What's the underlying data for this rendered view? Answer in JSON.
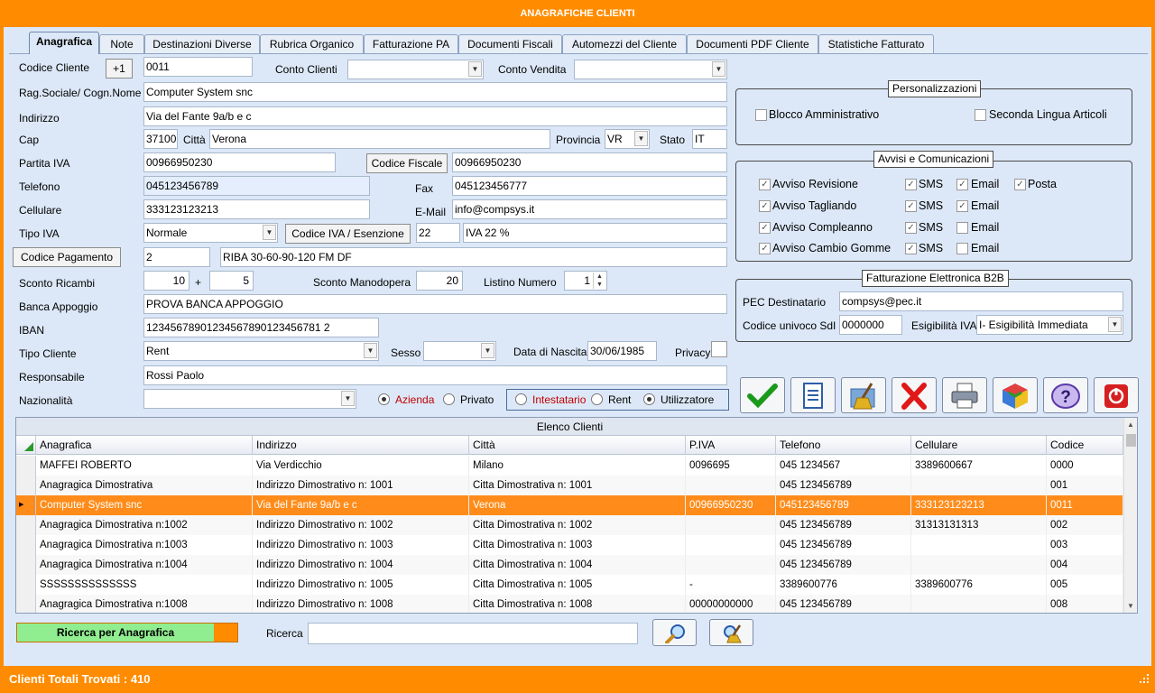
{
  "window": {
    "title": "ANAGRAFICHE CLIENTI",
    "status": "Clienti Totali Trovati : 410"
  },
  "tabs": [
    "Anagrafica",
    "Note",
    "Destinazioni Diverse",
    "Rubrica Organico",
    "Fatturazione PA",
    "Documenti Fiscali",
    "Automezzi del Cliente",
    "Documenti PDF Cliente",
    "Statistiche Fatturato"
  ],
  "form": {
    "codice_cliente_label": "Codice Cliente",
    "plus_one": "+1",
    "codice_cliente": "0011",
    "conto_clienti_label": "Conto Clienti",
    "conto_clienti": "",
    "conto_vendita_label": "Conto Vendita",
    "conto_vendita": "",
    "ragsoc_label": "Rag.Sociale/ Cogn.Nome",
    "ragsoc": "Computer System snc",
    "indirizzo_label": "Indirizzo",
    "indirizzo": "Via del Fante 9a/b e c",
    "cap_label": "Cap",
    "cap": "37100",
    "citta_label": "Città",
    "citta": "Verona",
    "provincia_label": "Provincia",
    "provincia": "VR",
    "stato_label": "Stato",
    "stato": "IT",
    "piva_label": "Partita IVA",
    "piva": "00966950230",
    "cf_button": "Codice Fiscale",
    "cf": "00966950230",
    "telefono_label": "Telefono",
    "telefono": "045123456789",
    "fax_label": "Fax",
    "fax": "045123456777",
    "cellulare_label": "Cellulare",
    "cellulare": "333123123213",
    "email_label": "E-Mail",
    "email": "info@compsys.it",
    "tipo_iva_label": "Tipo IVA",
    "tipo_iva": "Normale",
    "codice_iva_button": "Codice IVA / Esenzione",
    "codice_iva": "22",
    "iva_desc": "IVA 22 %",
    "pagamento_button": "Codice Pagamento",
    "pagamento_code": "2",
    "pagamento_desc": "RIBA 30-60-90-120 FM DF",
    "sconto_ricambi_label": "Sconto Ricambi",
    "sconto_ricambi": "10",
    "plus_sign": "+",
    "sconto_ricambi2": "5",
    "sconto_manodopera_label": "Sconto Manodopera",
    "sconto_manodopera": "20",
    "listino_label": "Listino Numero",
    "listino": "1",
    "banca_label": "Banca Appoggio",
    "banca": "PROVA BANCA APPOGGIO",
    "iban_label": "IBAN",
    "iban": "12345678901234567890123456781 2",
    "tipo_cliente_label": "Tipo Cliente",
    "tipo_cliente": "Rent",
    "sesso_label": "Sesso",
    "sesso": "",
    "nascita_label": "Data di Nascita",
    "nascita": "30/06/1985",
    "privacy_label": "Privacy",
    "responsabile_label": "Responsabile",
    "responsabile": "Rossi Paolo",
    "nazionalita_label": "Nazionalità",
    "nazionalita": "",
    "azienda": "Azienda",
    "privato": "Privato",
    "intestatario": "Intestatario",
    "rent": "Rent",
    "utilizzatore": "Utilizzatore"
  },
  "personalizzazioni": {
    "title": "Personalizzazioni",
    "blocco": "Blocco Amministrativo",
    "seconda_lingua": "Seconda Lingua Articoli"
  },
  "avvisi": {
    "title": "Avvisi e  Comunicazioni",
    "rows": [
      {
        "label": "Avviso Revisione",
        "sms": "SMS",
        "email": "Email",
        "posta": "Posta",
        "c": [
          true,
          true,
          true,
          true
        ]
      },
      {
        "label": "Avviso Tagliando",
        "sms": "SMS",
        "email": "Email",
        "c": [
          true,
          true,
          true
        ]
      },
      {
        "label": "Avviso Compleanno",
        "sms": "SMS",
        "email": "Email",
        "c": [
          true,
          true,
          false
        ]
      },
      {
        "label": "Avviso Cambio Gomme",
        "sms": "SMS",
        "email": "Email",
        "c": [
          true,
          true,
          false
        ]
      }
    ]
  },
  "fattura": {
    "title": "Fatturazione Elettronica B2B",
    "pec_label": "PEC Destinatario",
    "pec": "compsys@pec.it",
    "sdi_label": "Codice univoco SdI",
    "sdi": "0000000",
    "esig_label": "Esigibilità IVA",
    "esig": "I- Esigibilità Immediata"
  },
  "grid": {
    "title": "Elenco Clienti",
    "columns": [
      "Anagrafica",
      "Indirizzo",
      "Città",
      "P.IVA",
      "Telefono",
      "Cellulare",
      "Codice"
    ],
    "rows": [
      [
        "MAFFEI ROBERTO",
        "Via Verdicchio",
        "Milano",
        "0096695",
        "045 1234567",
        "3389600667",
        "0000"
      ],
      [
        "Anagragica Dimostrativa",
        "Indirizzo Dimostrativo n: 1001",
        "Citta Dimostrativa n: 1001",
        "",
        "045 123456789",
        "",
        "001"
      ],
      [
        "Computer System snc",
        "Via del Fante 9a/b e c",
        "Verona",
        "00966950230",
        "045123456789",
        "333123123213",
        "0011"
      ],
      [
        "Anagragica Dimostrativa n:1002",
        "Indirizzo Dimostrativo n: 1002",
        "Citta Dimostrativa n: 1002",
        "",
        "045 123456789",
        "31313131313",
        "002"
      ],
      [
        "Anagragica Dimostrativa n:1003",
        "Indirizzo Dimostrativo n: 1003",
        "Citta Dimostrativa n: 1003",
        "",
        "045 123456789",
        "",
        "003"
      ],
      [
        "Anagragica Dimostrativa n:1004",
        "Indirizzo Dimostrativo n: 1004",
        "Citta Dimostrativa n: 1004",
        "",
        "045 123456789",
        "",
        "004"
      ],
      [
        "SSSSSSSSSSSSSS",
        "Indirizzo Dimostrativo n: 1005",
        "Citta Dimostrativa n: 1005",
        "-",
        "3389600776",
        "3389600776",
        "005"
      ],
      [
        "Anagragica Dimostrativa n:1008",
        "Indirizzo Dimostrativo n: 1008",
        "Citta Dimostrativa n: 1008",
        "00000000000",
        "045 123456789",
        "",
        "008"
      ]
    ]
  },
  "search": {
    "mode": "Ricerca per Anagrafica",
    "label": "Ricerca",
    "value": ""
  },
  "colors": {
    "accent": "#ff8c00",
    "selected_row": "#ff8c1a",
    "panel": "#dce8f7"
  }
}
